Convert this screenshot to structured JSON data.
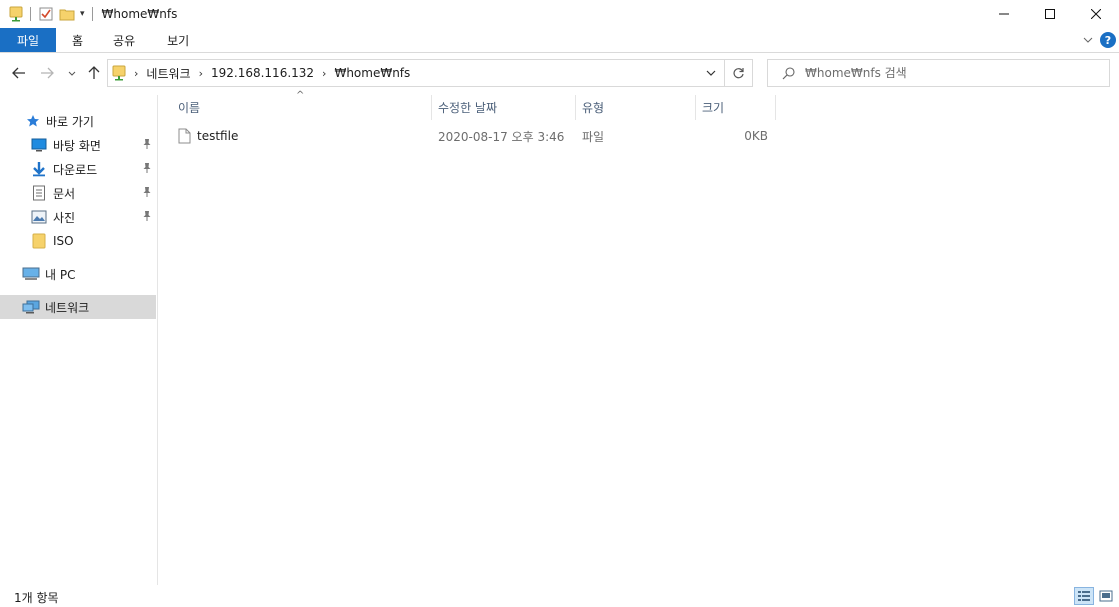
{
  "window": {
    "title": "₩home₩nfs",
    "controls": {
      "minimize": "—",
      "maximize": "☐",
      "close": "✕"
    }
  },
  "ribbon": {
    "tabs": [
      {
        "label": "파일",
        "active": true
      },
      {
        "label": "홈"
      },
      {
        "label": "공유"
      },
      {
        "label": "보기"
      }
    ],
    "collapse_icon": "chevron-down-icon",
    "help_label": "?",
    "accent": "#1a6fc4"
  },
  "navigation": {
    "back_icon": "arrow-left-icon",
    "forward_icon": "arrow-right-icon",
    "recent_icon": "chevron-down-icon",
    "up_icon": "arrow-up-icon"
  },
  "address": {
    "breadcrumb": [
      "네트워크",
      "192.168.116.132",
      "₩home₩nfs"
    ]
  },
  "search": {
    "placeholder": "₩home₩nfs 검색"
  },
  "sidebar": {
    "quick_access": {
      "label": "바로 가기"
    },
    "items": [
      {
        "label": "바탕 화면",
        "icon": "desktop-icon",
        "pinned": true
      },
      {
        "label": "다운로드",
        "icon": "download-icon",
        "pinned": true
      },
      {
        "label": "문서",
        "icon": "document-icon",
        "pinned": true
      },
      {
        "label": "사진",
        "icon": "pictures-icon",
        "pinned": true
      },
      {
        "label": "ISO",
        "icon": "folder-icon",
        "pinned": false
      }
    ],
    "this_pc": {
      "label": "내 PC"
    },
    "network": {
      "label": "네트워크",
      "selected": true
    }
  },
  "file_list": {
    "columns": [
      "이름",
      "수정한 날짜",
      "유형",
      "크기"
    ],
    "rows": [
      {
        "name": "testfile",
        "modified": "2020-08-17 오후 3:46",
        "type": "파일",
        "size": "0KB"
      }
    ]
  },
  "status_bar": {
    "item_count": "1개 항목"
  }
}
